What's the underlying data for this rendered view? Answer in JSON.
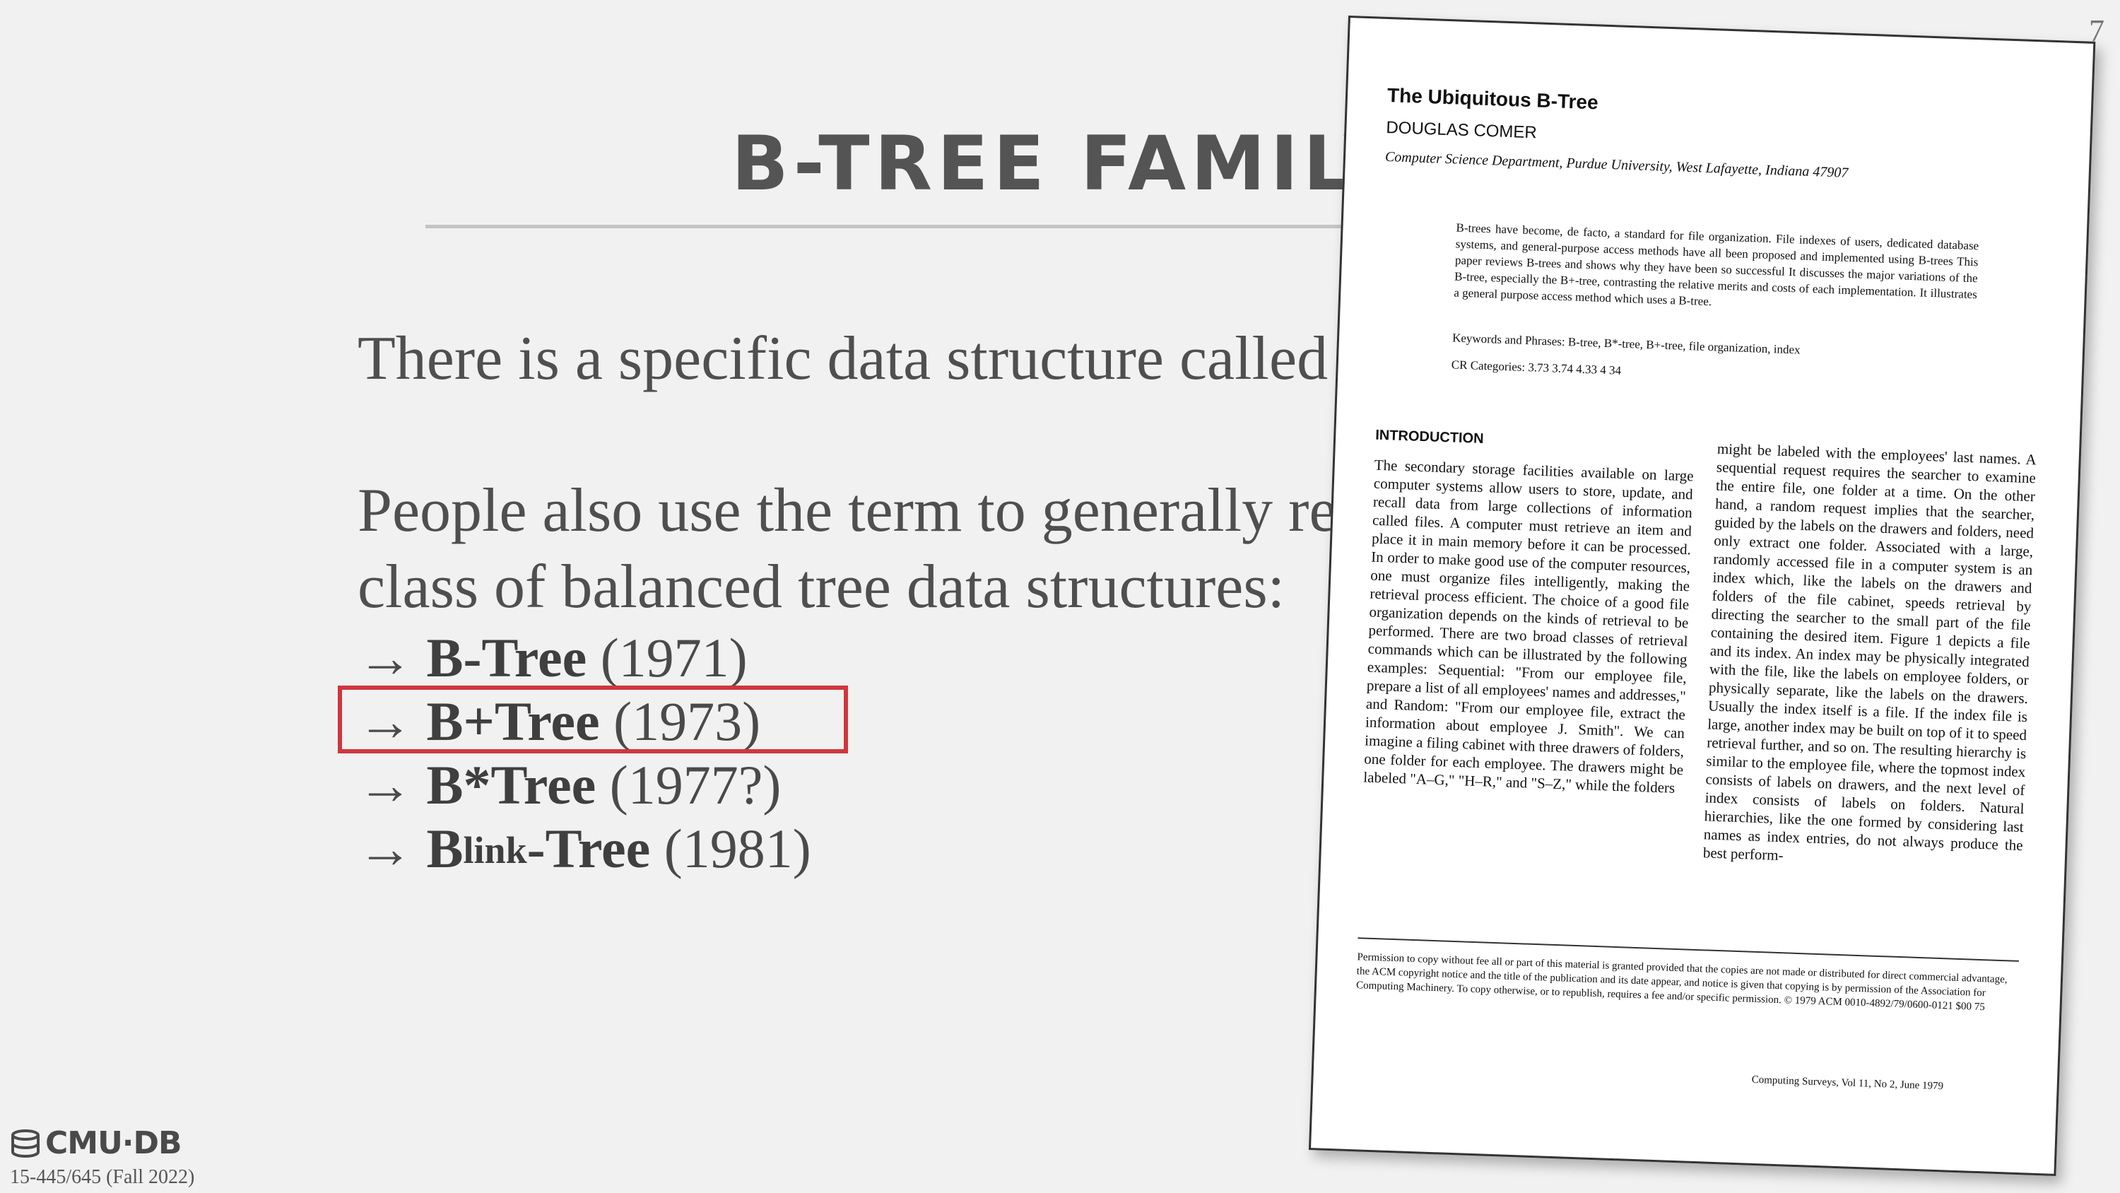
{
  "slide": {
    "number": "7",
    "title": "B-TREE FAMILY",
    "paragraph1": "There is a specific data structure called a B-Tree.",
    "paragraph2_line1": "People also use the term to generally refer to a",
    "paragraph2_line2": "class of balanced tree data structures:",
    "bullets": [
      {
        "arrow": "→",
        "name_prefix": "B",
        "name_sup": "",
        "name_suffix": "-Tree",
        "year": "(1971)"
      },
      {
        "arrow": "→",
        "name_prefix": "B+Tree",
        "name_sup": "",
        "name_suffix": "",
        "year": "(1973)"
      },
      {
        "arrow": "→",
        "name_prefix": "B*Tree",
        "name_sup": "",
        "name_suffix": "",
        "year": "(1977?)"
      },
      {
        "arrow": "→",
        "name_prefix": "B",
        "name_sup": "link",
        "name_suffix": "-Tree",
        "year": "(1981)"
      }
    ],
    "highlight_color": "#d0363c"
  },
  "footer": {
    "logo_text": "CMU·DB",
    "logo_icon": "database-icon",
    "course": "15-445/645 (Fall 2022)"
  },
  "paper": {
    "title": "The Ubiquitous B-Tree",
    "author": "DOUGLAS COMER",
    "affiliation": "Computer Science Department, Purdue University, West Lafayette, Indiana 47907",
    "abstract": "B-trees have become, de facto, a standard for file organization. File indexes of users, dedicated database systems, and general-purpose access methods have all been proposed and implemented using B-trees This paper reviews B-trees and shows why they have been so successful It discusses the major variations of the B-tree, especially the B+-tree, contrasting the relative merits and costs of each implementation. It illustrates a general purpose access method which uses a B-tree.",
    "keywords": "Keywords and Phrases: B-tree, B*-tree, B+-tree, file organization, index",
    "cr_categories": "CR Categories: 3.73 3.74 4.33 4 34",
    "intro_heading": "INTRODUCTION",
    "column1": "The secondary storage facilities available on large computer systems allow users to store, update, and recall data from large collections of information called files. A computer must retrieve an item and place it in main memory before it can be processed. In order to make good use of the computer resources, one must organize files intelligently, making the retrieval process efficient. The choice of a good file organization depends on the kinds of retrieval to be performed. There are two broad classes of retrieval commands which can be illustrated by the following examples: Sequential: \"From our employee file, prepare a list of all employees' names and addresses,\" and Random: \"From our employee file, extract the information about employee J. Smith\". We can imagine a filing cabinet with three drawers of folders, one folder for each employee. The drawers might be labeled \"A–G,\" \"H–R,\" and \"S–Z,\" while the folders",
    "column2": "might be labeled with the employees' last names. A sequential request requires the searcher to examine the entire file, one folder at a time. On the other hand, a random request implies that the searcher, guided by the labels on the drawers and folders, need only extract one folder. Associated with a large, randomly accessed file in a computer system is an index which, like the labels on the drawers and folders of the file cabinet, speeds retrieval by directing the searcher to the small part of the file containing the desired item. Figure 1 depicts a file and its index. An index may be physically integrated with the file, like the labels on employee folders, or physically separate, like the labels on the drawers. Usually the index itself is a file. If the index file is large, another index may be built on top of it to speed retrieval further, and so on. The resulting hierarchy is similar to the employee file, where the topmost index consists of labels on drawers, and the next level of index consists of labels on folders. Natural hierarchies, like the one formed by considering last names as index entries, do not always produce the best perform-",
    "permission": "Permission to copy without fee all or part of this material is granted provided that the copies are not made or distributed for direct commercial advantage, the ACM copyright notice and the title of the publication and its date appear, and notice is given that copying is by permission of the Association for Computing Machinery. To copy otherwise, or to republish, requires a fee and/or specific permission. © 1979 ACM 0010-4892/79/0600-0121 $00 75",
    "footer": "Computing Surveys, Vol 11, No 2, June 1979"
  }
}
